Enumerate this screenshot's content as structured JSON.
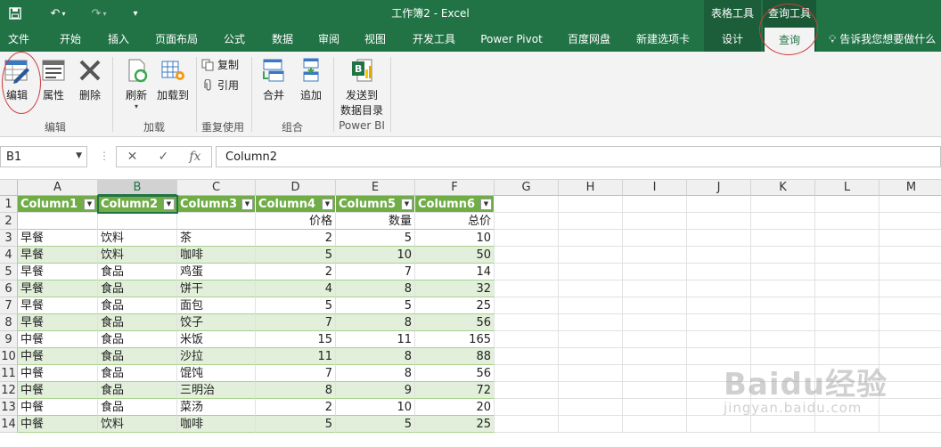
{
  "titlebar": {
    "title": "工作簿2 - Excel",
    "undo_icon": "undo-icon",
    "redo_icon": "redo-icon",
    "save_icon": "save-icon",
    "customize_icon": "customize-quick-access-icon"
  },
  "context_tabs": {
    "table_tools": "表格工具",
    "query_tools": "查询工具"
  },
  "tabs": [
    {
      "label": "文件"
    },
    {
      "label": "开始"
    },
    {
      "label": "插入"
    },
    {
      "label": "页面布局"
    },
    {
      "label": "公式"
    },
    {
      "label": "数据"
    },
    {
      "label": "审阅"
    },
    {
      "label": "视图"
    },
    {
      "label": "开发工具"
    },
    {
      "label": "Power Pivot"
    },
    {
      "label": "百度网盘"
    },
    {
      "label": "新建选项卡"
    },
    {
      "label": "设计"
    },
    {
      "label": "查询",
      "active": true
    }
  ],
  "tell_me": "告诉我您想要做什么",
  "ribbon": {
    "edit_label": "编辑",
    "properties_label": "属性",
    "delete_label": "删除",
    "group_edit": "编辑",
    "refresh_label": "刷新",
    "load_to_label": "加载到",
    "group_load": "加载",
    "duplicate_label": "复制",
    "reference_label": "引用",
    "group_reuse": "重复使用",
    "merge_label": "合并",
    "append_label": "追加",
    "group_combine": "组合",
    "send_label_1": "发送到",
    "send_label_2": "数据目录",
    "group_powerbi": "Power BI"
  },
  "formula_bar": {
    "name_box": "B1",
    "cancel": "✕",
    "enter": "✓",
    "fx": "fx",
    "value": "Column2"
  },
  "columns": [
    "A",
    "B",
    "C",
    "D",
    "E",
    "F",
    "G",
    "H",
    "I",
    "J",
    "K",
    "L",
    "M"
  ],
  "rows": [
    "1",
    "2",
    "3",
    "4",
    "5",
    "6",
    "7",
    "8",
    "9",
    "10",
    "11",
    "12",
    "13",
    "14"
  ],
  "table": {
    "headers": [
      "Column1",
      "Column2",
      "Column3",
      "Column4",
      "Column5",
      "Column6"
    ],
    "subheader": [
      "",
      "",
      "",
      "价格",
      "数量",
      "总价"
    ],
    "data": [
      [
        "早餐",
        "饮料",
        "茶",
        "2",
        "5",
        "10"
      ],
      [
        "早餐",
        "饮料",
        "咖啡",
        "5",
        "10",
        "50"
      ],
      [
        "早餐",
        "食品",
        "鸡蛋",
        "2",
        "7",
        "14"
      ],
      [
        "早餐",
        "食品",
        "饼干",
        "4",
        "8",
        "32"
      ],
      [
        "早餐",
        "食品",
        "面包",
        "5",
        "5",
        "25"
      ],
      [
        "早餐",
        "食品",
        "饺子",
        "7",
        "8",
        "56"
      ],
      [
        "中餐",
        "食品",
        "米饭",
        "15",
        "11",
        "165"
      ],
      [
        "中餐",
        "食品",
        "沙拉",
        "11",
        "8",
        "88"
      ],
      [
        "中餐",
        "食品",
        "馄饨",
        "7",
        "8",
        "56"
      ],
      [
        "中餐",
        "食品",
        "三明治",
        "8",
        "9",
        "72"
      ],
      [
        "中餐",
        "食品",
        "菜汤",
        "2",
        "10",
        "20"
      ],
      [
        "中餐",
        "饮料",
        "咖啡",
        "5",
        "5",
        "25"
      ]
    ]
  },
  "watermark": {
    "line1": "Baidu经验",
    "line2": "jingyan.baidu.com"
  },
  "colors": {
    "excel_green": "#217346",
    "table_header": "#70ad47",
    "band": "#e2efda"
  }
}
